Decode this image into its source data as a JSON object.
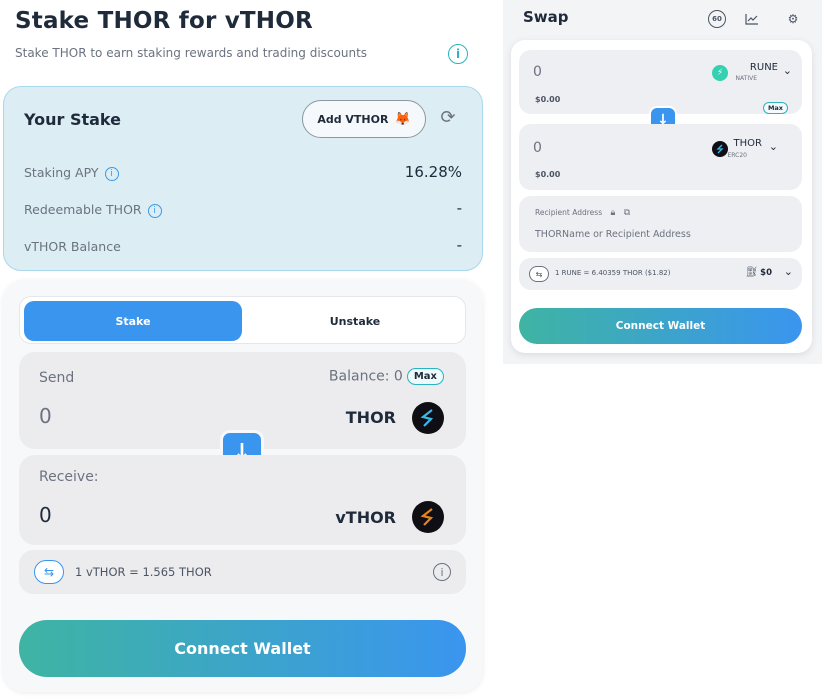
{
  "stake": {
    "title": "Stake THOR for vTHOR",
    "subtitle": "Stake THOR to earn staking rewards and trading discounts",
    "your_stake": {
      "title": "Your Stake",
      "add_button": "Add VTHOR",
      "rows": [
        {
          "label": "Staking APY",
          "value": "16.28%"
        },
        {
          "label": "Redeemable THOR",
          "value": "-"
        },
        {
          "label": "vTHOR Balance",
          "value": "-"
        }
      ]
    },
    "tabs": [
      "Stake",
      "Unstake"
    ],
    "send": {
      "label": "Send",
      "balance": "Balance: 0",
      "max": "Max",
      "amount": "0",
      "token": "THOR"
    },
    "receive": {
      "label": "Receive:",
      "amount": "0",
      "token": "vTHOR"
    },
    "rate": "1 vTHOR = 1.565 THOR",
    "connect": "Connect Wallet"
  },
  "swap": {
    "title": "Swap",
    "slippage_badge": "60",
    "from": {
      "amount": "0",
      "usd": "$0.00",
      "token": "RUNE",
      "network": "NATIVE",
      "max": "Max"
    },
    "to": {
      "amount": "0",
      "usd": "$0.00",
      "token": "THOR",
      "network": "ERC20"
    },
    "recipient": {
      "label": "Recipient Address",
      "placeholder": "THORName or Recipient Address"
    },
    "rate": "1 RUNE = 6.40359 THOR ($1.82)",
    "fee": "$0",
    "connect": "Connect Wallet"
  },
  "colors": {
    "accent": "#3a95ef",
    "teal": "#3fb4a3",
    "card": "#dcedf4"
  }
}
